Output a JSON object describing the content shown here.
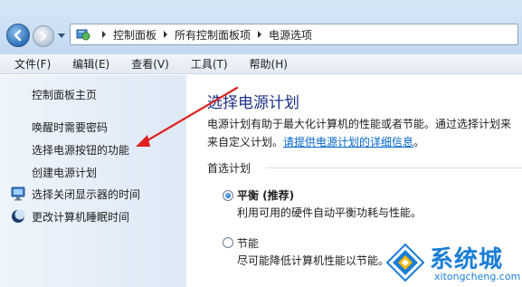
{
  "address_bar": {
    "crumbs": [
      "控制面板",
      "所有控制面板项",
      "电源选项"
    ]
  },
  "menu": {
    "items": [
      "文件(F)",
      "编辑(E)",
      "查看(V)",
      "工具(T)",
      "帮助(H)"
    ]
  },
  "sidebar": {
    "home": "控制面板主页",
    "links": [
      "唤醒时需要密码",
      "选择电源按钮的功能",
      "创建电源计划"
    ],
    "icon_links": [
      {
        "label": "选择关闭显示器的时间",
        "icon": "display-icon"
      },
      {
        "label": "更改计算机睡眠时间",
        "icon": "sleep-moon-icon"
      }
    ]
  },
  "main": {
    "title": "选择电源计划",
    "description_line1": "电源计划有助于最大化计算机的性能或者节能。通过选择计划来",
    "description_line2_prefix": "来自定义计划。",
    "description_link": "请提供电源计划的详细信息",
    "description_line2_suffix": "。",
    "section_label": "首选计划",
    "plans": [
      {
        "name": "平衡 (推荐)",
        "desc": "利用可用的硬件自动平衡功耗与性能。",
        "selected": true
      },
      {
        "name": "节能",
        "desc": "尽可能降低计算机性能以节能。",
        "selected": false
      }
    ]
  },
  "watermark": {
    "brand": "系统城",
    "site": "xitongcheng.com"
  },
  "colors": {
    "title_blue": "#1e3287",
    "link_blue": "#0066cc",
    "arrow_red": "#e02020",
    "watermark_blue": "#1a7ed6"
  }
}
